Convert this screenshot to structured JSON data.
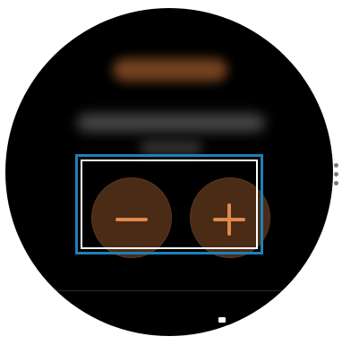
{
  "screen": {
    "title": "",
    "description_line1": "",
    "description_line2": ""
  },
  "controls": {
    "decrease_label": "−",
    "increase_label": "+"
  },
  "icons": {
    "decrease": "minus-icon",
    "increase": "plus-icon",
    "more": "more-options-icon"
  },
  "colors": {
    "button_fill": "#4a2b16",
    "icon_accent": "#e0894c",
    "highlight_border": "#1f7fb8",
    "background": "#000000"
  }
}
